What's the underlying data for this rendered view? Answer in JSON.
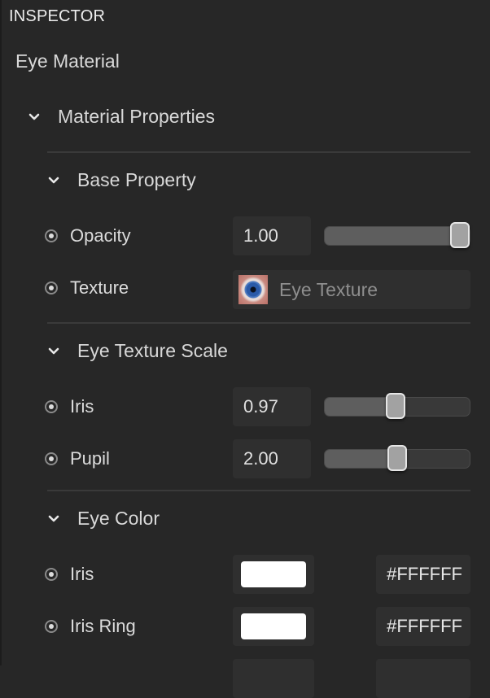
{
  "panel": {
    "title": "INSPECTOR"
  },
  "asset": {
    "name": "Eye Material"
  },
  "material_properties": {
    "label": "Material Properties",
    "expanded": true,
    "sections": {
      "base_property": {
        "label": "Base Property",
        "expanded": true,
        "opacity": {
          "label": "Opacity",
          "value": "1.00",
          "slider_fraction": 1.0
        },
        "texture": {
          "label": "Texture",
          "value": "Eye Texture"
        }
      },
      "eye_texture_scale": {
        "label": "Eye Texture Scale",
        "expanded": true,
        "iris": {
          "label": "Iris",
          "value": "0.97",
          "slider_fraction": 0.49
        },
        "pupil": {
          "label": "Pupil",
          "value": "2.00",
          "slider_fraction": 0.5
        }
      },
      "eye_color": {
        "label": "Eye Color",
        "expanded": true,
        "iris": {
          "label": "Iris",
          "swatch_color": "#FFFFFF",
          "hex": "#FFFFFF"
        },
        "iris_ring": {
          "label": "Iris Ring",
          "swatch_color": "#FFFFFF",
          "hex": "#FFFFFF"
        }
      }
    }
  }
}
